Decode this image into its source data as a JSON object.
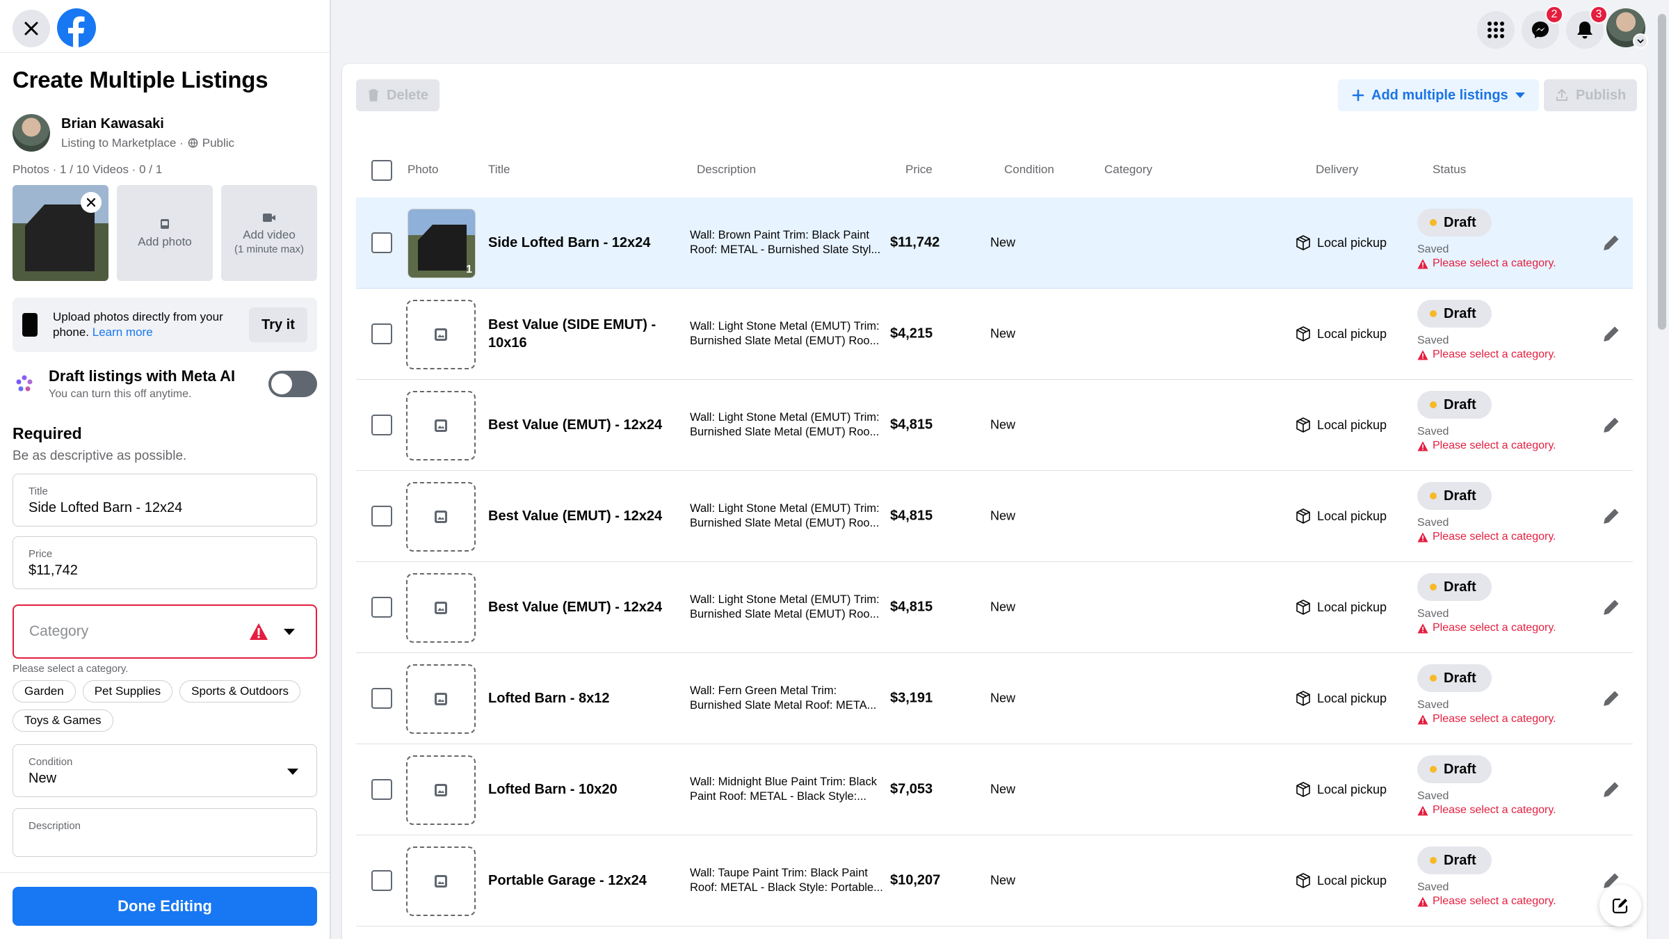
{
  "panel": {
    "title": "Create Multiple Listings",
    "user_name": "Brian Kawasaki",
    "user_sub": "Listing to Marketplace · ",
    "audience": "Public",
    "counts": "Photos · 1 / 10 Videos · 0 / 1",
    "add_photo": "Add photo",
    "add_video": "Add video",
    "add_video_sub": "(1 minute max)",
    "upload_text": "Upload photos directly from your phone. ",
    "learn_more": "Learn more",
    "try_it": "Try it",
    "ai_title": "Draft listings with Meta AI",
    "ai_sub": "You can turn this off anytime.",
    "required_title": "Required",
    "required_sub": "Be as descriptive as possible.",
    "title_label": "Title",
    "title_value": "Side Lofted Barn - 12x24",
    "price_label": "Price",
    "price_value": "$11,742",
    "category_placeholder": "Category",
    "category_error": "Please select a category.",
    "chips": [
      "Garden",
      "Pet Supplies",
      "Sports & Outdoors",
      "Toys & Games"
    ],
    "condition_label": "Condition",
    "condition_value": "New",
    "description_label": "Description",
    "done_label": "Done Editing"
  },
  "nav": {
    "messenger_badge": "2",
    "notifications_badge": "3"
  },
  "toolbar": {
    "delete_label": "Delete",
    "add_multiple_label": "Add multiple listings",
    "publish_label": "Publish"
  },
  "table": {
    "headers": [
      "Photo",
      "Title",
      "Description",
      "Price",
      "Condition",
      "Category",
      "Delivery",
      "Status"
    ],
    "rows": [
      {
        "title": "Side Lofted Barn - 12x24",
        "description": "Wall: Brown Paint Trim: Black Paint Roof: METAL - Burnished Slate Styl...",
        "price": "$11,742",
        "condition": "New",
        "delivery": "Local pickup",
        "status": "Draft",
        "saved": "Saved",
        "error": "Please select a category.",
        "photo_count": "1"
      },
      {
        "title": "Best Value (SIDE EMUT) - 10x16",
        "description": "Wall: Light Stone Metal (EMUT) Trim: Burnished Slate Metal (EMUT) Roo...",
        "price": "$4,215",
        "condition": "New",
        "delivery": "Local pickup",
        "status": "Draft",
        "saved": "Saved",
        "error": "Please select a category."
      },
      {
        "title": "Best Value (EMUT) - 12x24",
        "description": "Wall: Light Stone Metal (EMUT) Trim: Burnished Slate Metal (EMUT) Roo...",
        "price": "$4,815",
        "condition": "New",
        "delivery": "Local pickup",
        "status": "Draft",
        "saved": "Saved",
        "error": "Please select a category."
      },
      {
        "title": "Best Value (EMUT) - 12x24",
        "description": "Wall: Light Stone Metal (EMUT) Trim: Burnished Slate Metal (EMUT) Roo...",
        "price": "$4,815",
        "condition": "New",
        "delivery": "Local pickup",
        "status": "Draft",
        "saved": "Saved",
        "error": "Please select a category."
      },
      {
        "title": "Best Value (EMUT) - 12x24",
        "description": "Wall: Light Stone Metal (EMUT) Trim: Burnished Slate Metal (EMUT) Roo...",
        "price": "$4,815",
        "condition": "New",
        "delivery": "Local pickup",
        "status": "Draft",
        "saved": "Saved",
        "error": "Please select a category."
      },
      {
        "title": "Lofted Barn - 8x12",
        "description": "Wall: Fern Green Metal Trim: Burnished Slate Metal Roof: META...",
        "price": "$3,191",
        "condition": "New",
        "delivery": "Local pickup",
        "status": "Draft",
        "saved": "Saved",
        "error": "Please select a category."
      },
      {
        "title": "Lofted Barn - 10x20",
        "description": "Wall: Midnight Blue Paint Trim: Black Paint Roof: METAL - Black Style:...",
        "price": "$7,053",
        "condition": "New",
        "delivery": "Local pickup",
        "status": "Draft",
        "saved": "Saved",
        "error": "Please select a category."
      },
      {
        "title": "Portable Garage - 12x24",
        "description": "Wall: Taupe Paint Trim: Black Paint Roof: METAL - Black Style: Portable...",
        "price": "$10,207",
        "condition": "New",
        "delivery": "Local pickup",
        "status": "Draft",
        "saved": "Saved",
        "error": "Please select a category."
      }
    ]
  },
  "colors": {
    "accent": "#1877f2",
    "error": "#e41e3f",
    "draft_dot": "#f7b928",
    "selected_row": "#e7f3ff"
  }
}
